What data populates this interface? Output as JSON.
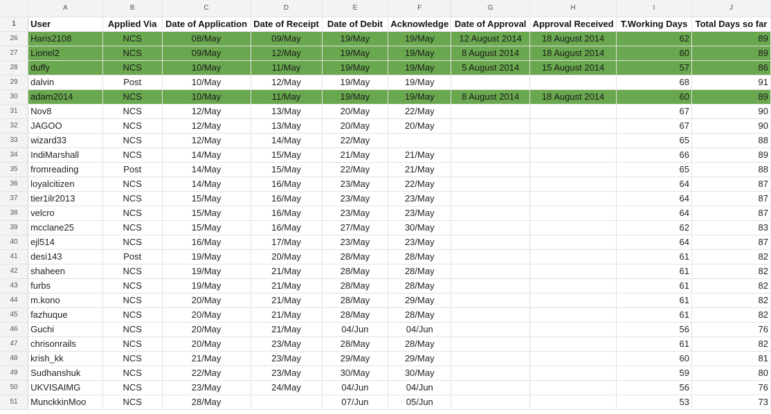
{
  "column_letters": [
    "A",
    "B",
    "C",
    "D",
    "E",
    "F",
    "G",
    "H",
    "I",
    "J"
  ],
  "header_row": {
    "row_number": "1",
    "cells": [
      "User",
      "Applied Via",
      "Date of Application",
      "Date of Receipt",
      "Date of Debit",
      "Acknowledge",
      "Date of Approval",
      "Approval Received",
      "T.Working Days",
      "Total Days so far"
    ]
  },
  "highlight_color": "#6aa84f",
  "rows": [
    {
      "n": "26",
      "green": true,
      "cells": [
        "Haris2108",
        "NCS",
        "08/May",
        "09/May",
        "19/May",
        "19/May",
        "12 August 2014",
        "18 August 2014",
        "62",
        "89"
      ]
    },
    {
      "n": "27",
      "green": true,
      "cells": [
        "Lionel2",
        "NCS",
        "09/May",
        "12/May",
        "19/May",
        "19/May",
        "8 August 2014",
        "18 August 2014",
        "60",
        "89"
      ]
    },
    {
      "n": "28",
      "green": true,
      "cells": [
        "duffy",
        "NCS",
        "10/May",
        "11/May",
        "19/May",
        "19/May",
        "5 August 2014",
        "15 August 2014",
        "57",
        "86"
      ]
    },
    {
      "n": "29",
      "green": false,
      "cells": [
        "dalvin",
        "Post",
        "10/May",
        "12/May",
        "19/May",
        "19/May",
        "",
        "",
        "68",
        "91"
      ]
    },
    {
      "n": "30",
      "green": true,
      "cells": [
        "adam2014",
        "NCS",
        "10/May",
        "11/May",
        "19/May",
        "19/May",
        "8 August 2014",
        "18 August 2014",
        "60",
        "89"
      ]
    },
    {
      "n": "31",
      "green": false,
      "cells": [
        "Nov8",
        "NCS",
        "12/May",
        "13/May",
        "20/May",
        "22/May",
        "",
        "",
        "67",
        "90"
      ]
    },
    {
      "n": "32",
      "green": false,
      "cells": [
        "JAGOO",
        "NCS",
        "12/May",
        "13/May",
        "20/May",
        "20/May",
        "",
        "",
        "67",
        "90"
      ]
    },
    {
      "n": "33",
      "green": false,
      "cells": [
        "wizard33",
        "NCS",
        "12/May",
        "14/May",
        "22/May",
        "",
        "",
        "",
        "65",
        "88"
      ]
    },
    {
      "n": "34",
      "green": false,
      "cells": [
        "IndiMarshall",
        "NCS",
        "14/May",
        "15/May",
        "21/May",
        "21/May",
        "",
        "",
        "66",
        "89"
      ]
    },
    {
      "n": "35",
      "green": false,
      "cells": [
        "fromreading",
        "Post",
        "14/May",
        "15/May",
        "22/May",
        "21/May",
        "",
        "",
        "65",
        "88"
      ]
    },
    {
      "n": "36",
      "green": false,
      "cells": [
        "loyalcitizen",
        "NCS",
        "14/May",
        "16/May",
        "23/May",
        "22/May",
        "",
        "",
        "64",
        "87"
      ]
    },
    {
      "n": "37",
      "green": false,
      "cells": [
        "tier1ilr2013",
        "NCS",
        "15/May",
        "16/May",
        "23/May",
        "23/May",
        "",
        "",
        "64",
        "87"
      ]
    },
    {
      "n": "38",
      "green": false,
      "cells": [
        "velcro",
        "NCS",
        "15/May",
        "16/May",
        "23/May",
        "23/May",
        "",
        "",
        "64",
        "87"
      ]
    },
    {
      "n": "39",
      "green": false,
      "cells": [
        "mcclane25",
        "NCS",
        "15/May",
        "16/May",
        "27/May",
        "30/May",
        "",
        "",
        "62",
        "83"
      ]
    },
    {
      "n": "40",
      "green": false,
      "cells": [
        "ejl514",
        "NCS",
        "16/May",
        "17/May",
        "23/May",
        "23/May",
        "",
        "",
        "64",
        "87"
      ]
    },
    {
      "n": "41",
      "green": false,
      "cells": [
        "desi143",
        "Post",
        "19/May",
        "20/May",
        "28/May",
        "28/May",
        "",
        "",
        "61",
        "82"
      ]
    },
    {
      "n": "42",
      "green": false,
      "cells": [
        "shaheen",
        "NCS",
        "19/May",
        "21/May",
        "28/May",
        "28/May",
        "",
        "",
        "61",
        "82"
      ]
    },
    {
      "n": "43",
      "green": false,
      "cells": [
        "furbs",
        "NCS",
        "19/May",
        "21/May",
        "28/May",
        "28/May",
        "",
        "",
        "61",
        "82"
      ]
    },
    {
      "n": "44",
      "green": false,
      "cells": [
        "m.kono",
        "NCS",
        "20/May",
        "21/May",
        "28/May",
        "29/May",
        "",
        "",
        "61",
        "82"
      ]
    },
    {
      "n": "45",
      "green": false,
      "cells": [
        "fazhuque",
        "NCS",
        "20/May",
        "21/May",
        "28/May",
        "28/May",
        "",
        "",
        "61",
        "82"
      ]
    },
    {
      "n": "46",
      "green": false,
      "cells": [
        "Guchi",
        "NCS",
        "20/May",
        "21/May",
        "04/Jun",
        "04/Jun",
        "",
        "",
        "56",
        "76"
      ]
    },
    {
      "n": "47",
      "green": false,
      "cells": [
        "chrisonrails",
        "NCS",
        "20/May",
        "23/May",
        "28/May",
        "28/May",
        "",
        "",
        "61",
        "82"
      ]
    },
    {
      "n": "48",
      "green": false,
      "cells": [
        "krish_kk",
        "NCS",
        "21/May",
        "23/May",
        "29/May",
        "29/May",
        "",
        "",
        "60",
        "81"
      ]
    },
    {
      "n": "49",
      "green": false,
      "cells": [
        "Sudhanshuk",
        "NCS",
        "22/May",
        "23/May",
        "30/May",
        "30/May",
        "",
        "",
        "59",
        "80"
      ]
    },
    {
      "n": "50",
      "green": false,
      "cells": [
        "UKVISAIMG",
        "NCS",
        "23/May",
        "24/May",
        "04/Jun",
        "04/Jun",
        "",
        "",
        "56",
        "76"
      ]
    },
    {
      "n": "51",
      "green": false,
      "cells": [
        "MunckkinMoo",
        "NCS",
        "28/May",
        "",
        "07/Jun",
        "05/Jun",
        "",
        "",
        "53",
        "73"
      ]
    }
  ]
}
